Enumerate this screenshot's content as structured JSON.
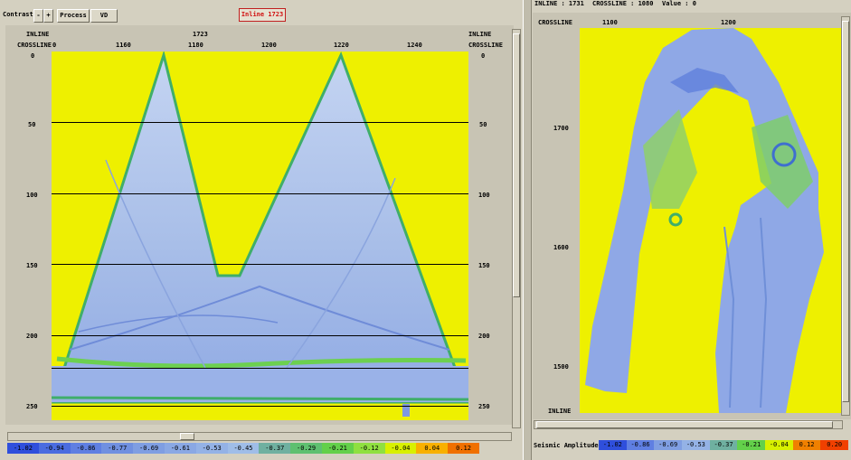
{
  "toolbar": {
    "contrast_label": "Contrast",
    "minus_label": "-",
    "plus_label": "+",
    "process_label": "Process",
    "vd_label": "VD",
    "inline_badge": "Inline 1723"
  },
  "left_panel": {
    "top_title": "1723",
    "corner_inline": "INLINE",
    "corner_crossline": "CROSSLINE",
    "x_ticks": [
      "0",
      "1160",
      "1180",
      "1200",
      "1220",
      "1240"
    ],
    "y_ticks": [
      "0",
      "50",
      "100",
      "150",
      "200",
      "250"
    ],
    "right_y_ticks": [
      "0",
      "50",
      "100",
      "150",
      "200",
      "250"
    ]
  },
  "right_panel": {
    "status_inline_label": "INLINE : 1731",
    "status_crossline_label": "CROSSLINE : 1080",
    "status_value_label": "Value : 0",
    "corner_crossline": "CROSSLINE",
    "corner_inline": "INLINE",
    "x_ticks": [
      "1100",
      "1200"
    ],
    "y_ticks": [
      "1700",
      "1600",
      "1500"
    ]
  },
  "left_colorbar": {
    "labels": [
      "-1.02",
      "-0.94",
      "-0.86",
      "-0.77",
      "-0.69",
      "-0.61",
      "-0.53",
      "-0.45",
      "-0.37",
      "-0.29",
      "-0.21",
      "-0.12",
      "-0.04",
      "0.04",
      "0.12"
    ],
    "colors": [
      "#2f4fdc",
      "#4a6ce0",
      "#5f7fe2",
      "#7090e0",
      "#7f9ee2",
      "#8aa8e4",
      "#94b2e6",
      "#9fbde8",
      "#6fb0a0",
      "#5ec070",
      "#63d04a",
      "#8fe040",
      "#d8f000",
      "#f8b000",
      "#f07000"
    ]
  },
  "right_colorbar": {
    "title": "Seismic Amplitude",
    "labels": [
      "-1.02",
      "-0.86",
      "-0.69",
      "-0.53",
      "-0.37",
      "-0.21",
      "-0.04",
      "0.12",
      "0.20"
    ],
    "colors": [
      "#2f4fdc",
      "#5f7fe2",
      "#7f9ee2",
      "#94b2e6",
      "#6fb0a0",
      "#63d04a",
      "#d8f000",
      "#f08000",
      "#f04000"
    ]
  }
}
